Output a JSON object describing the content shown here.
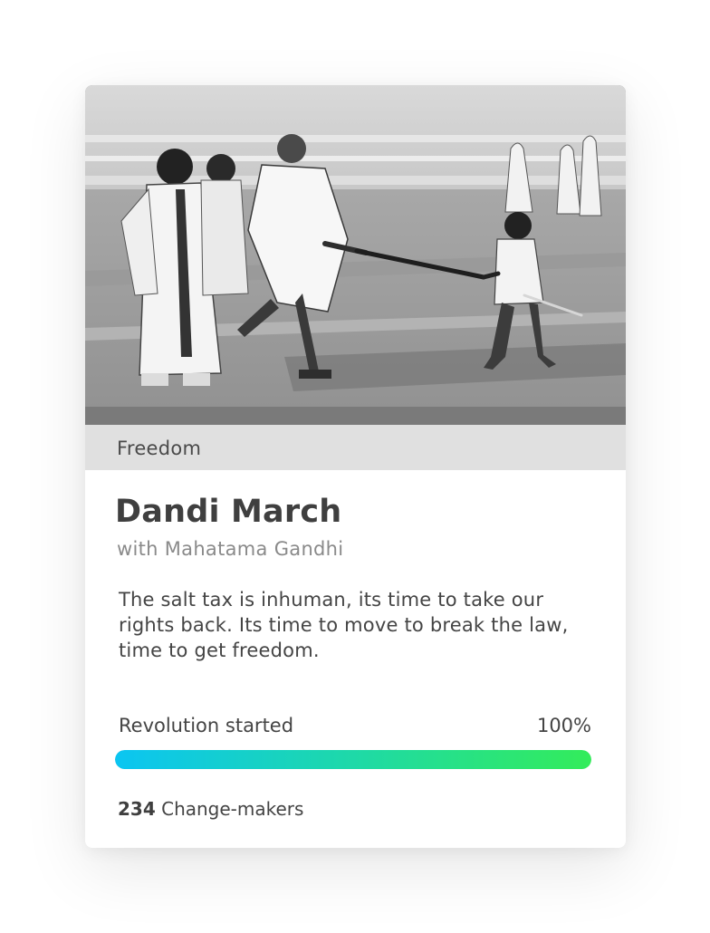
{
  "card": {
    "category": "Freedom",
    "title": "Dandi March",
    "subtitle": "with Mahatama Gandhi",
    "description": "The salt tax is inhuman, its time to take our rights back. Its time to move to break the law, time to get freedom.",
    "progress": {
      "label": "Revolution started",
      "percent_text": "100%",
      "value": 1.0
    },
    "supporters": {
      "count": "234",
      "label": "Change-makers"
    }
  },
  "colors": {
    "progress_start": "#0bc5f2",
    "progress_end": "#33ec5a",
    "text_dark": "#3f3f3f",
    "text_muted": "#8a8a8a"
  }
}
